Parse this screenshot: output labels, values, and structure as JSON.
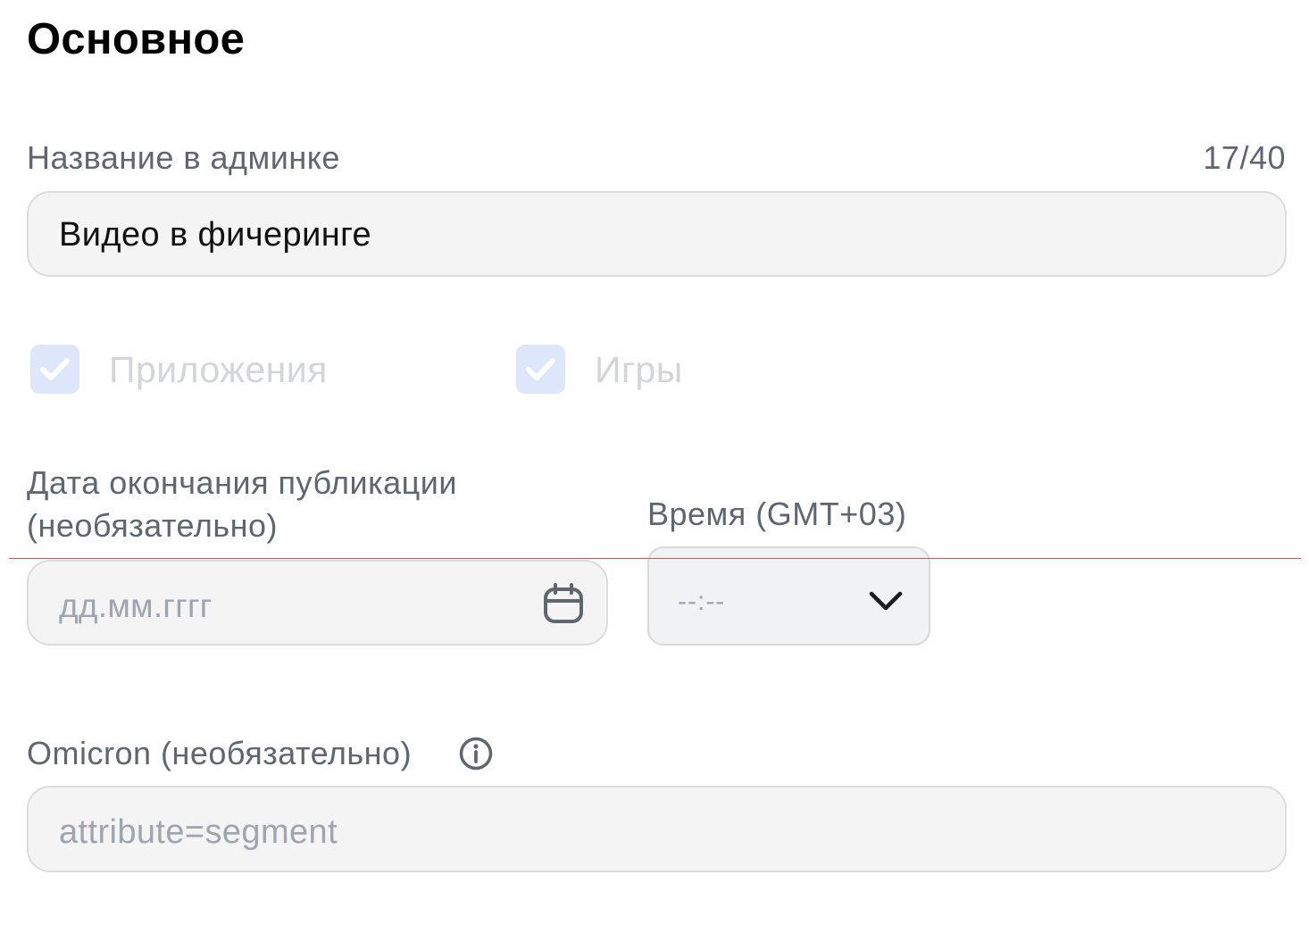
{
  "section": {
    "title": "Основное"
  },
  "admin_name": {
    "label": "Название в админке",
    "counter": "17/40",
    "value": "Видео в фичеринге"
  },
  "checkboxes": [
    {
      "label": "Приложения",
      "checked": true,
      "disabled": true
    },
    {
      "label": "Игры",
      "checked": true,
      "disabled": true
    }
  ],
  "end_date": {
    "label": "Дата окончания публикации (необязательно)",
    "placeholder": "дд.мм.гггг",
    "icon": "calendar-icon"
  },
  "time": {
    "label": "Время (GMT+03)",
    "placeholder": "--:--",
    "icon": "chevron-down-icon"
  },
  "omicron": {
    "label": "Omicron (необязательно)",
    "placeholder": "attribute=segment",
    "icon": "info-icon"
  },
  "colors": {
    "checkbox_fill": "#dde6fb",
    "checkmark": "#ffffff",
    "label_text": "#5f6670",
    "placeholder_text": "#9ea5b0",
    "field_background": "#f4f4f4"
  }
}
